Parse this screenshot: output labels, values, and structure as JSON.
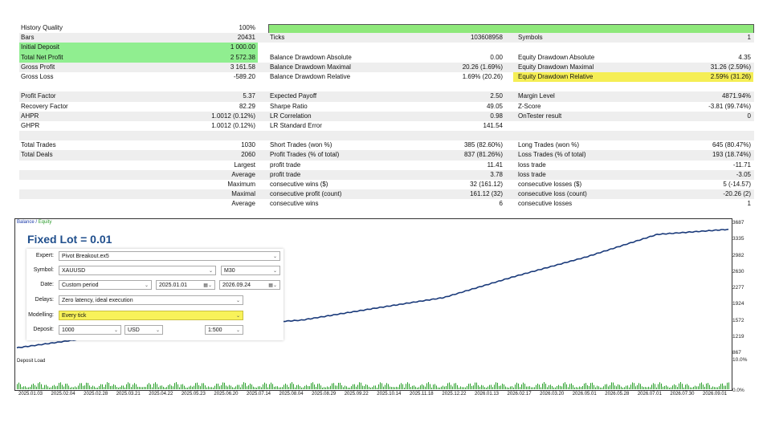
{
  "report": {
    "history_quality_label": "History Quality",
    "history_quality_value": "100%",
    "rows": [
      {
        "l1": "Bars",
        "v1": "20431",
        "l2": "Ticks",
        "v2": "103608958",
        "l3": "Symbols",
        "v3": "1",
        "gray": true
      },
      {
        "l1": "Initial Deposit",
        "v1": "1 000.00",
        "l2": "",
        "v2": "",
        "l3": "",
        "v3": "",
        "green": true
      },
      {
        "l1": "Total Net Profit",
        "v1": "2 572.38",
        "l2": "Balance Drawdown Absolute",
        "v2": "0.00",
        "l3": "Equity Drawdown Absolute",
        "v3": "4.35",
        "green": true
      },
      {
        "l1": "Gross Profit",
        "v1": "3 161.58",
        "l2": "Balance Drawdown Maximal",
        "v2": "20.26 (1.69%)",
        "l3": "Equity Drawdown Maximal",
        "v3": "31.26 (2.59%)",
        "gray": true
      },
      {
        "l1": "Gross Loss",
        "v1": "-589.20",
        "l2": "Balance Drawdown Relative",
        "v2": "1.69% (20.26)",
        "l3": "Equity Drawdown Relative",
        "v3": "2.59% (31.26)",
        "yellow": true
      },
      {
        "spacer": true
      },
      {
        "l1": "Profit Factor",
        "v1": "5.37",
        "l2": "Expected Payoff",
        "v2": "2.50",
        "l3": "Margin Level",
        "v3": "4871.94%",
        "gray": true
      },
      {
        "l1": "Recovery Factor",
        "v1": "82.29",
        "l2": "Sharpe Ratio",
        "v2": "49.05",
        "l3": "Z-Score",
        "v3": "-3.81 (99.74%)"
      },
      {
        "l1": "AHPR",
        "v1": "1.0012 (0.12%)",
        "l2": "LR Correlation",
        "v2": "0.98",
        "l3": "OnTester result",
        "v3": "0",
        "gray": true
      },
      {
        "l1": "GHPR",
        "v1": "1.0012 (0.12%)",
        "l2": "LR Standard Error",
        "v2": "141.54",
        "l3": "",
        "v3": ""
      },
      {
        "spacer": true,
        "gray": true
      },
      {
        "l1": "Total Trades",
        "v1": "1030",
        "l2": "Short Trades (won %)",
        "v2": "385 (82.60%)",
        "l3": "Long Trades (won %)",
        "v3": "645 (80.47%)"
      },
      {
        "l1": "Total Deals",
        "v1": "2060",
        "l2": "Profit Trades (% of total)",
        "v2": "837 (81.26%)",
        "l3": "Loss Trades (% of total)",
        "v3": "193 (18.74%)",
        "gray": true
      },
      {
        "l1": "",
        "v1": "Largest",
        "l2": "profit trade",
        "v2": "11.41",
        "l3": "loss trade",
        "v3": "-11.71"
      },
      {
        "l1": "",
        "v1": "Average",
        "l2": "profit trade",
        "v2": "3.78",
        "l3": "loss trade",
        "v3": "-3.05",
        "gray": true
      },
      {
        "l1": "",
        "v1": "Maximum",
        "l2": "consecutive wins ($)",
        "v2": "32 (161.12)",
        "l3": "consecutive losses ($)",
        "v3": "5 (-14.57)"
      },
      {
        "l1": "",
        "v1": "Maximal",
        "l2": "consecutive profit (count)",
        "v2": "161.12 (32)",
        "l3": "consecutive loss (count)",
        "v3": "-20.26 (2)",
        "gray": true
      },
      {
        "l1": "",
        "v1": "Average",
        "l2": "consecutive wins",
        "v2": "6",
        "l3": "consecutive losses",
        "v3": "1"
      }
    ]
  },
  "chart": {
    "legend_balance": "Balance",
    "legend_sep": " / ",
    "legend_equity": "Equity",
    "overlay_title": "Fixed Lot = 0.01",
    "y_ticks": [
      "3687",
      "3335",
      "2982",
      "2630",
      "2277",
      "1924",
      "1572",
      "1219",
      "867"
    ],
    "deposit_load_title": "Deposit Load",
    "deposit_load_ticks": [
      "10.0%",
      "0.0%"
    ],
    "x_ticks": [
      "2025.01.03",
      "2025.02.04",
      "2025.02.28",
      "2025.03.21",
      "2025.04.22",
      "2025.05.23",
      "2025.06.20",
      "2025.07.14",
      "2025.08.04",
      "2025.08.29",
      "2025.09.22",
      "2025.10.14",
      "2025.11.18",
      "2025.12.22",
      "2026.01.13",
      "2026.02.17",
      "2026.03.20",
      "2026.05.01",
      "2026.05.28",
      "2026.07.01",
      "2026.07.30",
      "2026.09.01"
    ],
    "colors": {
      "balance": "#1a3a7a",
      "equity": "#3f6fd0",
      "deposit": "#2aa02a"
    }
  },
  "chart_data": {
    "type": "line",
    "title": "",
    "series": [
      {
        "name": "Balance",
        "x": [
          "2025.01.03",
          "2025.03.21",
          "2025.05.23",
          "2025.07.14",
          "2025.09.22",
          "2025.11.18",
          "2026.01.13",
          "2026.03.20",
          "2026.05.28",
          "2026.07.30",
          "2026.09.01"
        ],
        "values": [
          1000,
          1210,
          1310,
          1500,
          1600,
          1850,
          2090,
          2550,
          2970,
          3460,
          3570
        ]
      }
    ],
    "ylim": [
      867,
      3687
    ]
  },
  "tester": {
    "expert_label": "Expert:",
    "expert_value": "Pivot Breakout.ex5",
    "symbol_label": "Symbol:",
    "symbol_value": "XAUUSD",
    "period_value": "M30",
    "date_label": "Date:",
    "date_mode": "Custom period",
    "date_from": "2025.01.01",
    "date_to": "2026.09.24",
    "delays_label": "Delays:",
    "delays_value": "Zero latency, ideal execution",
    "modelling_label": "Modelling:",
    "modelling_value": "Every tick",
    "deposit_label": "Deposit:",
    "deposit_value": "1000",
    "currency_value": "USD",
    "leverage_value": "1:500"
  }
}
